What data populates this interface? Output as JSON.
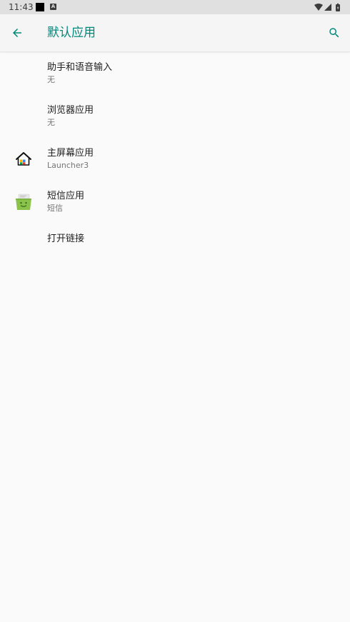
{
  "status_bar": {
    "time": "11:43",
    "notif_letter": "A"
  },
  "app_bar": {
    "title": "默认应用"
  },
  "items": [
    {
      "title": "助手和语音输入",
      "summary": "无"
    },
    {
      "title": "浏览器应用",
      "summary": "无"
    },
    {
      "title": "主屏幕应用",
      "summary": "Launcher3"
    },
    {
      "title": "短信应用",
      "summary": "短信"
    },
    {
      "title": "打开链接"
    }
  ],
  "colors": {
    "accent": "#00897b",
    "background": "#fafafa",
    "status_bar": "#e0e0e0",
    "app_bar": "#f5f5f5",
    "title_text": "#212121",
    "summary_text": "#757575",
    "messaging_icon": "#8bc34a"
  },
  "icons": {
    "back": "arrow-back-icon",
    "search": "search-icon",
    "home_app": "house-icon",
    "sms_app": "messaging-icon",
    "status_wifi": "wifi-icon",
    "status_signal": "signal-icon",
    "status_battery": "battery-icon"
  }
}
